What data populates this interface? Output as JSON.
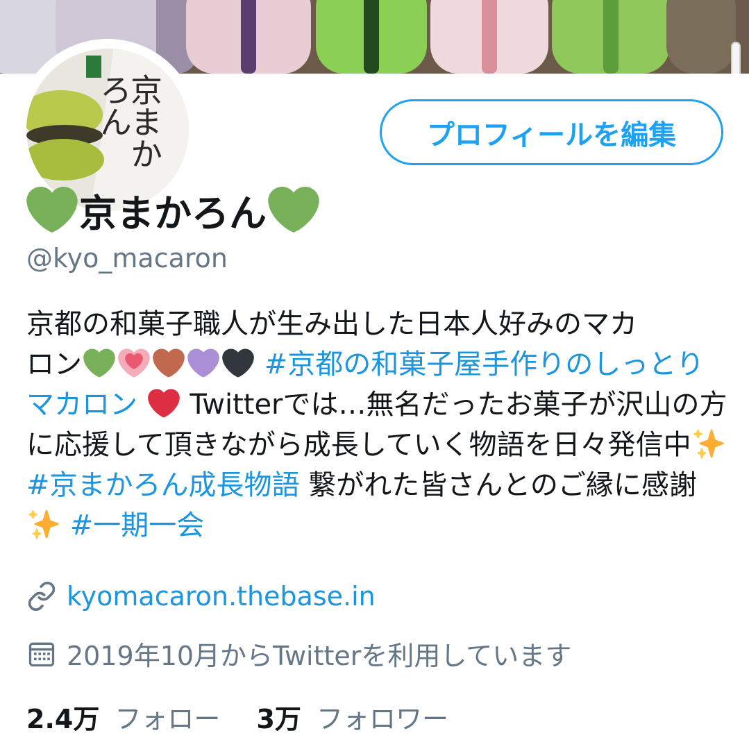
{
  "header": {
    "edit_button_label": "プロフィールを編集"
  },
  "avatar": {
    "script_text": "京まかろん"
  },
  "profile": {
    "display_name": "京まかろん",
    "handle": "@kyo_macaron"
  },
  "bio": {
    "line1": "京都の和菓子職人が生み出した日本人好みのマカ",
    "line2_text": "ロン",
    "hashtag1": "#京都の和菓子屋手作りのしっとりマカロン",
    "text_after_heart": " Twitterでは…無名だったお菓子が沢山の方に応援して頂きながら成長していく物語を日々発信中",
    "hashtag2": "#京まかろん成長物語",
    "text_mid": " 繋がれた皆さんとのご縁に感謝",
    "hashtag3": "#一期一会"
  },
  "meta": {
    "website": "kyomacaron.thebase.in",
    "joined": "2019年10月からTwitterを利用しています"
  },
  "stats": {
    "following_count": "2.4万",
    "following_label": "フォロー",
    "followers_count": "3万",
    "followers_label": "フォロワー"
  },
  "colors": {
    "accent": "#1da1f2",
    "link": "#1b95e0",
    "secondary_text": "#657786",
    "green_heart": "#78b159",
    "pink_heart": "#f4abba",
    "brown_heart": "#c1694f",
    "purple_heart": "#aa8ed6",
    "black_heart": "#31373d",
    "red_heart": "#dd2e44",
    "sparkles": "#ffcc4d"
  },
  "icons": {
    "link": "link-icon",
    "calendar": "calendar-icon"
  }
}
